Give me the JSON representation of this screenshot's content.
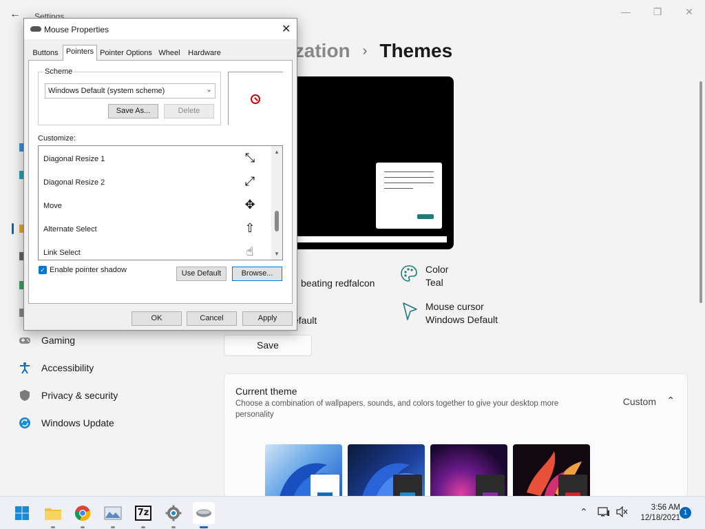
{
  "settings": {
    "title": "Settings",
    "breadcrumb": {
      "parent": "ization",
      "separator": "›",
      "current": "Themes"
    },
    "info": {
      "background_partial": "beating redfalcon",
      "color_label": "Color",
      "color_value": "Teal",
      "sound_partial": "efault",
      "cursor_label": "Mouse cursor",
      "cursor_value": "Windows Default"
    },
    "save_label": "Save",
    "current_theme": {
      "title": "Current theme",
      "description": "Choose a combination of wallpapers, sounds, and colors together to give your desktop more personality",
      "value": "Custom"
    },
    "nav": [
      {
        "label": "Gaming",
        "icon": "gamepad-icon"
      },
      {
        "label": "Accessibility",
        "icon": "accessibility-icon"
      },
      {
        "label": "Privacy & security",
        "icon": "shield-icon"
      },
      {
        "label": "Windows Update",
        "icon": "update-icon"
      }
    ],
    "theme_colors": {
      "accent": "#1f7a7a",
      "link": "#0067c0"
    }
  },
  "dialog": {
    "title": "Mouse Properties",
    "tabs": [
      "Buttons",
      "Pointers",
      "Pointer Options",
      "Wheel",
      "Hardware"
    ],
    "active_tab": "Pointers",
    "scheme_label": "Scheme",
    "scheme_value": "Windows Default (system scheme)",
    "save_as_label": "Save As...",
    "delete_label": "Delete",
    "customize_label": "Customize:",
    "cursors": [
      {
        "name": "Diagonal Resize 1",
        "glyph": "⤡"
      },
      {
        "name": "Diagonal Resize 2",
        "glyph": "⤢"
      },
      {
        "name": "Move",
        "glyph": "✥"
      },
      {
        "name": "Alternate Select",
        "glyph": "⇧"
      },
      {
        "name": "Link Select",
        "glyph": "☝"
      }
    ],
    "shadow_label": "Enable pointer shadow",
    "shadow_checked": true,
    "use_default_label": "Use Default",
    "browse_label": "Browse...",
    "ok_label": "OK",
    "cancel_label": "Cancel",
    "apply_label": "Apply"
  },
  "taskbar": {
    "time": "3:56 AM",
    "date": "12/18/2021",
    "notification_count": "1",
    "sevenzip_label": "7z"
  }
}
